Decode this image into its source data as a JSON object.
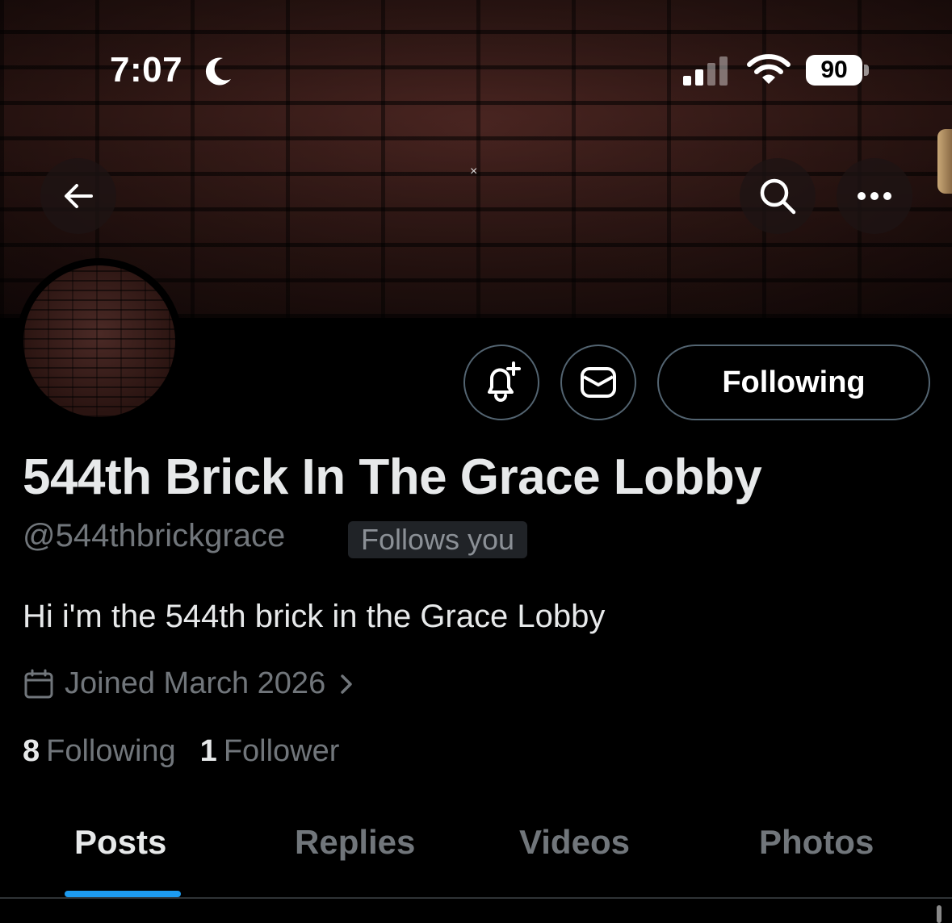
{
  "status_bar": {
    "time": "7:07",
    "battery": "90",
    "icons": [
      "moon-icon",
      "cellular-signal-icon",
      "wifi-icon",
      "battery-icon"
    ]
  },
  "banner": {
    "overlay_mark": "×"
  },
  "nav": {
    "icons": [
      "back-arrow-icon",
      "search-icon",
      "more-options-icon"
    ]
  },
  "actions": {
    "icons": [
      "notification-bell-add-icon",
      "message-envelope-icon"
    ],
    "following_label": "Following"
  },
  "profile": {
    "name": "544th Brick In The Grace Lobby",
    "handle": "@544thbrickgrace",
    "follows_you": "Follows you",
    "bio": "Hi i'm the 544th brick in the Grace Lobby",
    "joined": "Joined March 2026",
    "following_count": "8",
    "following_label": "Following",
    "followers_count": "1",
    "followers_label": "Follower"
  },
  "tabs": [
    {
      "label": "Posts",
      "active": true
    },
    {
      "label": "Replies",
      "active": false
    },
    {
      "label": "Videos",
      "active": false
    },
    {
      "label": "Photos",
      "active": false
    }
  ],
  "colors": {
    "background": "#000000",
    "accent": "#1d9bf0",
    "primary_text": "#e7e9ea",
    "secondary_text": "#71767b",
    "border": "#536471"
  }
}
